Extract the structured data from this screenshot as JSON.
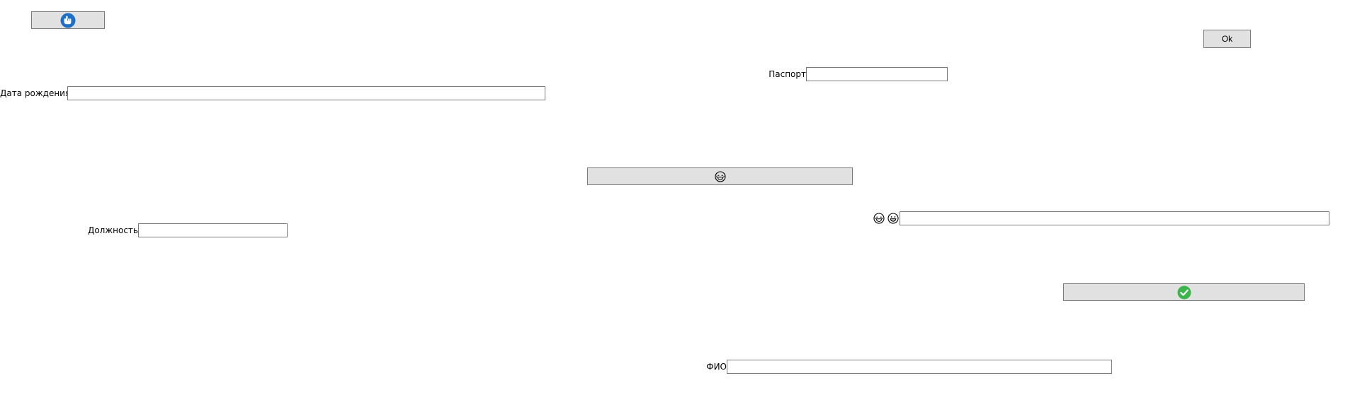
{
  "buttons": {
    "ok_label": "Ok"
  },
  "labels": {
    "birth_date": "Дата рождения",
    "passport": "Паспорт",
    "position": "Должность",
    "full_name": "ФИО"
  },
  "fields": {
    "birth_date_value": "",
    "passport_value": "",
    "position_value": "",
    "emoji_field_value": "",
    "full_name_value": ""
  },
  "icons": {
    "top_left_button": "pointing-hand-icon",
    "center_button": "laughing-face-icon",
    "emoji_pair": [
      "laughing-face-icon",
      "grinning-face-icon"
    ],
    "confirm_button": "check-circle-icon"
  },
  "colors": {
    "button_bg": "#e1e1e1",
    "button_border": "#7a7a7a",
    "hand_icon_blue": "#1e6fc8",
    "check_icon_green": "#3cb54a"
  }
}
